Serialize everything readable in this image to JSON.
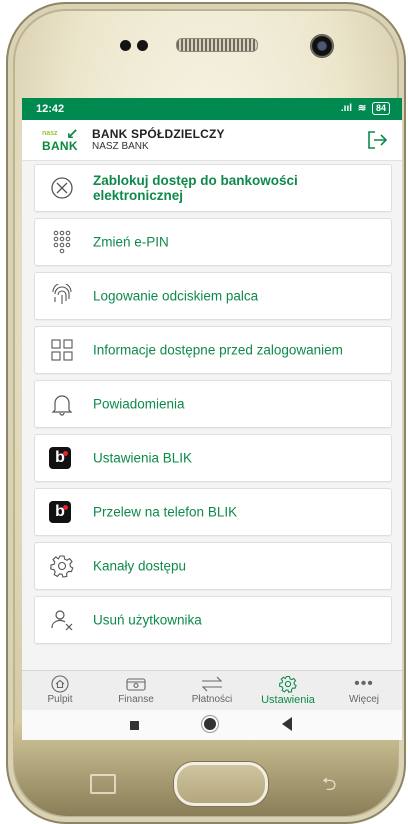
{
  "status": {
    "time": "12:42",
    "battery": "84"
  },
  "header": {
    "bank_name": "BANK SPÓŁDZIELCZY",
    "bank_sub": "NASZ BANK",
    "logo_small": "nasz",
    "logo_big": "BANK"
  },
  "menu": {
    "items": [
      {
        "label": "Zablokuj dostęp do bankowości elektronicznej",
        "icon": "block-icon"
      },
      {
        "label": "Zmień e-PIN",
        "icon": "keypad-icon"
      },
      {
        "label": "Logowanie odciskiem palca",
        "icon": "fingerprint-icon"
      },
      {
        "label": "Informacje dostępne przed zalogowaniem",
        "icon": "grid-icon"
      },
      {
        "label": "Powiadomienia",
        "icon": "bell-icon"
      },
      {
        "label": "Ustawienia BLIK",
        "icon": "blik-icon"
      },
      {
        "label": "Przelew na telefon BLIK",
        "icon": "blik-icon"
      },
      {
        "label": "Kanały dostępu",
        "icon": "gear-icon"
      },
      {
        "label": "Usuń użytkownika",
        "icon": "remove-user-icon"
      }
    ]
  },
  "nav": {
    "items": [
      {
        "label": "Pulpit"
      },
      {
        "label": "Finanse"
      },
      {
        "label": "Płatności"
      },
      {
        "label": "Ustawienia"
      },
      {
        "label": "Więcej"
      }
    ]
  },
  "blik_glyph": "b",
  "colors": {
    "brand": "#008a4f",
    "link": "#0d8a4a"
  }
}
